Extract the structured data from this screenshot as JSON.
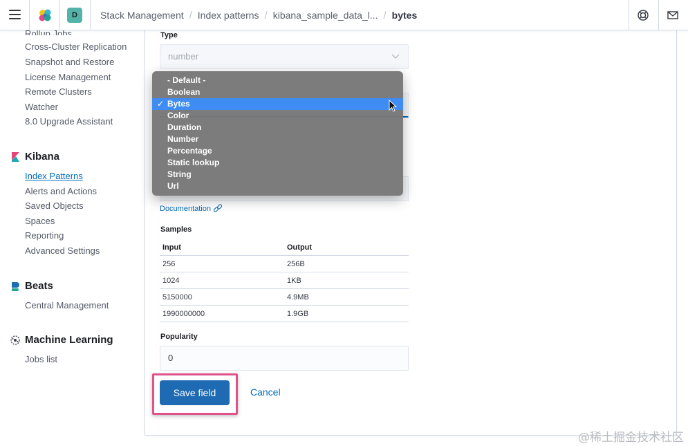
{
  "header": {
    "space_initial": "D",
    "breadcrumbs": [
      {
        "label": "Stack Management"
      },
      {
        "label": "Index patterns"
      },
      {
        "label": "kibana_sample_data_l..."
      }
    ],
    "current_crumb": "bytes"
  },
  "sidebar": {
    "stack_items": [
      {
        "label": "Rollup Jobs"
      },
      {
        "label": "Cross-Cluster Replication"
      },
      {
        "label": "Snapshot and Restore"
      },
      {
        "label": "License Management"
      },
      {
        "label": "Remote Clusters"
      },
      {
        "label": "Watcher"
      },
      {
        "label": "8.0 Upgrade Assistant"
      }
    ],
    "kibana": {
      "title": "Kibana",
      "items": [
        {
          "label": "Index Patterns"
        },
        {
          "label": "Alerts and Actions"
        },
        {
          "label": "Saved Objects"
        },
        {
          "label": "Spaces"
        },
        {
          "label": "Reporting"
        },
        {
          "label": "Advanced Settings"
        }
      ]
    },
    "beats": {
      "title": "Beats",
      "items": [
        {
          "label": "Central Management"
        }
      ]
    },
    "ml": {
      "title": "Machine Learning",
      "items": [
        {
          "label": "Jobs list"
        }
      ]
    }
  },
  "form": {
    "type_label": "Type",
    "type_value": "number",
    "format_options": [
      {
        "label": "- Default -"
      },
      {
        "label": "Boolean"
      },
      {
        "label": "Bytes"
      },
      {
        "label": "Color"
      },
      {
        "label": "Duration"
      },
      {
        "label": "Number"
      },
      {
        "label": "Percentage"
      },
      {
        "label": "Static lookup"
      },
      {
        "label": "String"
      },
      {
        "label": "Url"
      }
    ],
    "selected_format": "Bytes",
    "selected_check": "✓",
    "documentation_link": "Documentation",
    "samples_label": "Samples",
    "samples_columns": {
      "input": "Input",
      "output": "Output"
    },
    "samples": [
      {
        "input": "256",
        "output": "256B"
      },
      {
        "input": "1024",
        "output": "1KB"
      },
      {
        "input": "5150000",
        "output": "4.9MB"
      },
      {
        "input": "1990000000",
        "output": "1.9GB"
      }
    ],
    "popularity_label": "Popularity",
    "popularity_value": "0",
    "save_label": "Save field",
    "cancel_label": "Cancel"
  },
  "colors": {
    "accent": "#006bb8",
    "save_button": "#1f6bb3",
    "highlight": "#e0538a",
    "dropdown_selected": "#3f8cf2"
  },
  "watermark": "@稀土掘金技术社区"
}
